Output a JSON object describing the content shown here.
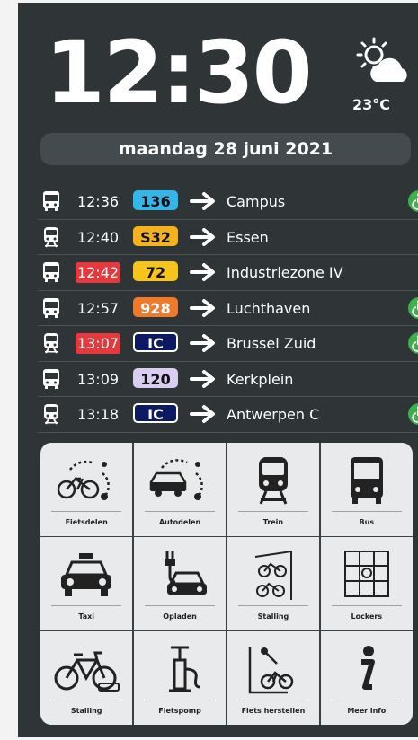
{
  "clock": "12:30",
  "weather": {
    "icon": "partly-cloudy-icon",
    "temperature": "23°C"
  },
  "date": "maandag 28 juni 2021",
  "departures": [
    {
      "mode": "bus-icon",
      "time": "12:36",
      "late": false,
      "line": "136",
      "line_bg": "#35b6e8",
      "line_fg": "#111111",
      "line_border": "#35b6e8",
      "destination": "Campus",
      "accessible": true
    },
    {
      "mode": "train-icon",
      "time": "12:40",
      "late": false,
      "line": "S32",
      "line_bg": "#f4b21c",
      "line_fg": "#111111",
      "line_border": "#f4b21c",
      "destination": "Essen",
      "accessible": false
    },
    {
      "mode": "bus-icon",
      "time": "12:42",
      "late": true,
      "line": "72",
      "line_bg": "#f6c51b",
      "line_fg": "#111111",
      "line_border": "#f6c51b",
      "destination": "Industriezone IV",
      "accessible": false
    },
    {
      "mode": "bus-icon",
      "time": "12:57",
      "late": false,
      "line": "928",
      "line_bg": "#ef7a2b",
      "line_fg": "#ffffff",
      "line_border": "#ef7a2b",
      "destination": "Luchthaven",
      "accessible": true
    },
    {
      "mode": "train-icon",
      "time": "13:07",
      "late": true,
      "line": "IC",
      "line_bg": "#0c1a63",
      "line_fg": "#ffffff",
      "line_border": "#ffffff",
      "destination": "Brussel Zuid",
      "accessible": true
    },
    {
      "mode": "bus-icon",
      "time": "13:09",
      "late": false,
      "line": "120",
      "line_bg": "#d9cdf1",
      "line_fg": "#111111",
      "line_border": "#d9cdf1",
      "destination": "Kerkplein",
      "accessible": false
    },
    {
      "mode": "train-icon",
      "time": "13:18",
      "late": false,
      "line": "IC",
      "line_bg": "#0c1a63",
      "line_fg": "#ffffff",
      "line_border": "#ffffff",
      "destination": "Antwerpen C",
      "accessible": true
    }
  ],
  "tiles": [
    {
      "label": "Fietsdelen",
      "icon": "bike-share-icon"
    },
    {
      "label": "Autodelen",
      "icon": "car-share-icon"
    },
    {
      "label": "Trein",
      "icon": "train-icon"
    },
    {
      "label": "Bus",
      "icon": "bus-icon"
    },
    {
      "label": "Taxi",
      "icon": "taxi-icon"
    },
    {
      "label": "Opladen",
      "icon": "ev-charging-icon"
    },
    {
      "label": "Stalling",
      "icon": "bike-rack-icon"
    },
    {
      "label": "Lockers",
      "icon": "locker-icon"
    },
    {
      "label": "Stalling",
      "icon": "bicycle-icon"
    },
    {
      "label": "Fietspomp",
      "icon": "bike-pump-icon"
    },
    {
      "label": "Fiets herstellen",
      "icon": "bike-repair-icon"
    },
    {
      "label": "Meer info",
      "icon": "info-icon"
    }
  ]
}
